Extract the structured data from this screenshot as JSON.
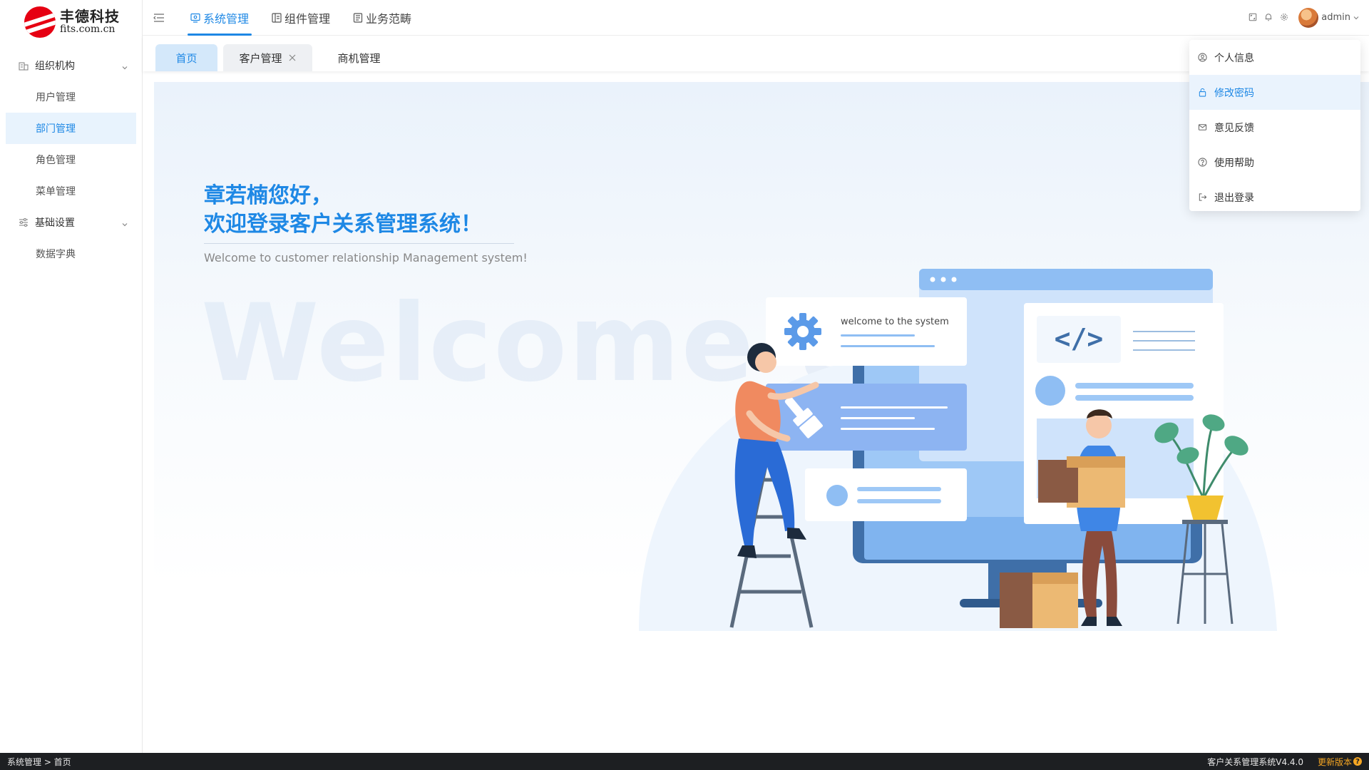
{
  "brand": {
    "name_cn": "丰德科技",
    "domain": "fits.com.cn",
    "accent": "#1e88e5",
    "logo_red": "#e60012"
  },
  "sidebar": {
    "groups": [
      {
        "label": "组织机构",
        "icon": "org-icon",
        "items": [
          {
            "label": "用户管理"
          },
          {
            "label": "部门管理",
            "active": true
          },
          {
            "label": "角色管理"
          },
          {
            "label": "菜单管理"
          }
        ]
      },
      {
        "label": "基础设置",
        "icon": "settings-sliders-icon",
        "items": [
          {
            "label": "数据字典"
          }
        ]
      }
    ]
  },
  "header": {
    "nav": [
      {
        "label": "系统管理",
        "icon": "monitor-icon",
        "active": true
      },
      {
        "label": "组件管理",
        "icon": "component-icon"
      },
      {
        "label": "业务范畴",
        "icon": "doc-icon"
      }
    ],
    "user": {
      "name": "admin"
    },
    "icons": [
      "fullscreen-icon",
      "bell-icon",
      "gear-icon"
    ]
  },
  "tabs": [
    {
      "label": "首页",
      "active": true
    },
    {
      "label": "客户管理",
      "closable": true
    },
    {
      "label": "商机管理"
    }
  ],
  "welcome": {
    "line1": "章若楠您好，",
    "line2": "欢迎登录客户关系管理系统！",
    "subtitle": "Welcome to customer relationship Management system!",
    "watermark": "Welcome to",
    "card_text": "welcome to the system"
  },
  "user_menu": [
    {
      "label": "个人信息",
      "icon": "user-circle-icon"
    },
    {
      "label": "修改密码",
      "icon": "lock-icon",
      "active": true
    },
    {
      "label": "意见反馈",
      "icon": "mail-icon"
    },
    {
      "label": "使用帮助",
      "icon": "help-icon"
    },
    {
      "label": "退出登录",
      "icon": "logout-icon"
    }
  ],
  "statusbar": {
    "breadcrumb": "系统管理 > 首页",
    "version": "客户关系管理系统V4.4.0",
    "update": "更新版本",
    "update_badge": "?"
  }
}
